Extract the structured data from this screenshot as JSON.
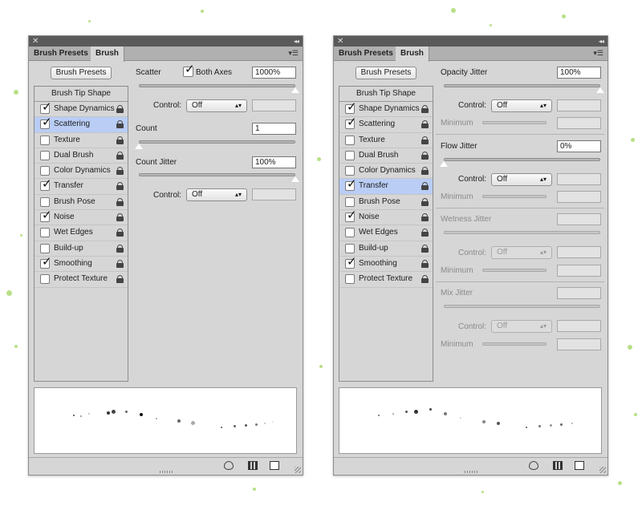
{
  "panels": [
    {
      "titlebar": {
        "close": "✕",
        "collapse": "◂◂"
      },
      "tabs": [
        "Brush Presets",
        "Brush"
      ],
      "menu_icon": "panel-menu-icon",
      "presets_button": "Brush Presets",
      "list_header": "Brush Tip Shape",
      "items": [
        {
          "label": "Shape Dynamics",
          "checked": true,
          "selected": false
        },
        {
          "label": "Scattering",
          "checked": true,
          "selected": true
        },
        {
          "label": "Texture",
          "checked": false,
          "selected": false
        },
        {
          "label": "Dual Brush",
          "checked": false,
          "selected": false
        },
        {
          "label": "Color Dynamics",
          "checked": false,
          "selected": false
        },
        {
          "label": "Transfer",
          "checked": true,
          "selected": false
        },
        {
          "label": "Brush Pose",
          "checked": false,
          "selected": false
        },
        {
          "label": "Noise",
          "checked": true,
          "selected": false
        },
        {
          "label": "Wet Edges",
          "checked": false,
          "selected": false
        },
        {
          "label": "Build-up",
          "checked": false,
          "selected": false
        },
        {
          "label": "Smoothing",
          "checked": true,
          "selected": false
        },
        {
          "label": "Protect Texture",
          "checked": false,
          "selected": false
        }
      ],
      "scattering": {
        "scatter_label": "Scatter",
        "both_axes_label": "Both Axes",
        "both_axes_checked": true,
        "scatter_value": "1000%",
        "scatter_level": 1.0,
        "control_label": "Control:",
        "control_value": "Off",
        "count_label": "Count",
        "count_value": "1",
        "count_level": 0.0,
        "count_jitter_label": "Count Jitter",
        "count_jitter_value": "100%",
        "count_jitter_level": 1.0,
        "control2_label": "Control:",
        "control2_value": "Off"
      }
    },
    {
      "titlebar": {
        "close": "✕",
        "collapse": "◂◂"
      },
      "tabs": [
        "Brush Presets",
        "Brush"
      ],
      "menu_icon": "panel-menu-icon",
      "presets_button": "Brush Presets",
      "list_header": "Brush Tip Shape",
      "items": [
        {
          "label": "Shape Dynamics",
          "checked": true,
          "selected": false
        },
        {
          "label": "Scattering",
          "checked": true,
          "selected": false
        },
        {
          "label": "Texture",
          "checked": false,
          "selected": false
        },
        {
          "label": "Dual Brush",
          "checked": false,
          "selected": false
        },
        {
          "label": "Color Dynamics",
          "checked": false,
          "selected": false
        },
        {
          "label": "Transfer",
          "checked": true,
          "selected": true
        },
        {
          "label": "Brush Pose",
          "checked": false,
          "selected": false
        },
        {
          "label": "Noise",
          "checked": true,
          "selected": false
        },
        {
          "label": "Wet Edges",
          "checked": false,
          "selected": false
        },
        {
          "label": "Build-up",
          "checked": false,
          "selected": false
        },
        {
          "label": "Smoothing",
          "checked": true,
          "selected": false
        },
        {
          "label": "Protect Texture",
          "checked": false,
          "selected": false
        }
      ],
      "transfer": {
        "opacity_jitter_label": "Opacity Jitter",
        "opacity_jitter_value": "100%",
        "opacity_jitter_level": 1.0,
        "control_label": "Control:",
        "control_value": "Off",
        "minimum_label": "Minimum",
        "flow_jitter_label": "Flow Jitter",
        "flow_jitter_value": "0%",
        "flow_jitter_level": 0.0,
        "control2_label": "Control:",
        "control2_value": "Off",
        "minimum2_label": "Minimum",
        "wetness_jitter_label": "Wetness Jitter",
        "control3_label": "Control:",
        "control3_value": "Off",
        "minimum3_label": "Minimum",
        "mix_jitter_label": "Mix Jitter",
        "control4_label": "Control:",
        "control4_value": "Off",
        "minimum4_label": "Minimum"
      }
    }
  ],
  "colors": {
    "panel_bg": "#d6d6d6",
    "selection": "#b9cdf5",
    "splatter": "#a8d86a"
  }
}
